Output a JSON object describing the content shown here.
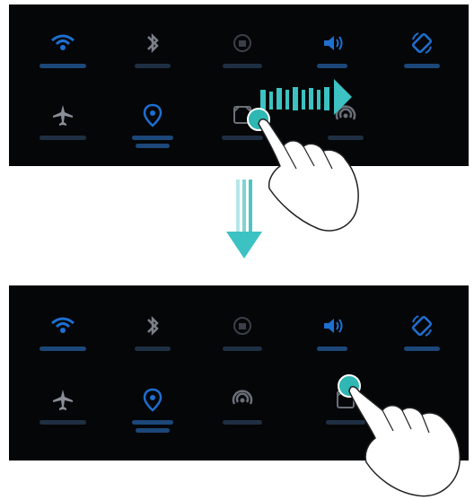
{
  "panels": [
    {
      "id": "before",
      "row1": [
        {
          "icon": "wifi-icon",
          "active": true,
          "color": "#1e6fd0"
        },
        {
          "icon": "bluetooth-icon",
          "active": false,
          "color": "#7a7f88"
        },
        {
          "icon": "rotation-lock-icon",
          "active": false,
          "color": "#3a3f48"
        },
        {
          "icon": "sound-icon",
          "active": true,
          "color": "#1e6fd0"
        },
        {
          "icon": "auto-rotate-icon",
          "active": true,
          "color": "#1e6fd0"
        }
      ],
      "row2": [
        {
          "icon": "airplane-icon",
          "active": false,
          "color": "#8a8f98"
        },
        {
          "icon": "location-icon",
          "active": true,
          "color": "#1e6fd0"
        },
        {
          "icon": "screenshot-icon",
          "active": false,
          "color": "#6a6f78"
        },
        {
          "icon": "hotspot-icon",
          "active": false,
          "color": "#6a6f78"
        }
      ],
      "gesture": "press-and-drag-right"
    },
    {
      "id": "after",
      "row1": [
        {
          "icon": "wifi-icon",
          "active": true,
          "color": "#1e6fd0"
        },
        {
          "icon": "bluetooth-icon",
          "active": false,
          "color": "#7a7f88"
        },
        {
          "icon": "rotation-lock-icon",
          "active": false,
          "color": "#3a3f48"
        },
        {
          "icon": "sound-icon",
          "active": true,
          "color": "#1e6fd0"
        },
        {
          "icon": "auto-rotate-icon",
          "active": true,
          "color": "#1e6fd0"
        }
      ],
      "row2": [
        {
          "icon": "airplane-icon",
          "active": false,
          "color": "#8a8f98"
        },
        {
          "icon": "location-icon",
          "active": true,
          "color": "#1e6fd0"
        },
        {
          "icon": "hotspot-icon",
          "active": false,
          "color": "#6a6f78"
        },
        {
          "icon": "screenshot-icon",
          "active": false,
          "color": "#6a6f78"
        }
      ],
      "gesture": "release"
    }
  ],
  "colors": {
    "panel_bg": "#050608",
    "accent": "#1e6fd0",
    "touch_dot": "#2fb7b3",
    "arrow": "#3cc2c2"
  }
}
